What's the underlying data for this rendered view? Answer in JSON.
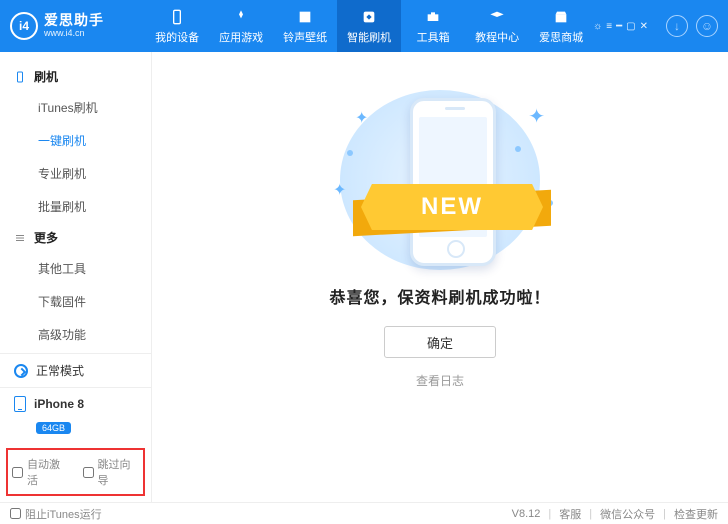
{
  "header": {
    "brand": "爱思助手",
    "url": "www.i4.cn",
    "logo_text": "i4",
    "tabs": [
      {
        "label": "我的设备"
      },
      {
        "label": "应用游戏"
      },
      {
        "label": "铃声壁纸"
      },
      {
        "label": "智能刷机"
      },
      {
        "label": "工具箱"
      },
      {
        "label": "教程中心"
      },
      {
        "label": "爱思商城"
      }
    ],
    "download_glyph": "↓",
    "user_glyph": "☺"
  },
  "sidebar": {
    "sections": [
      {
        "title": "刷机",
        "items": [
          "iTunes刷机",
          "一键刷机",
          "专业刷机",
          "批量刷机"
        ],
        "active_index": 1
      },
      {
        "title": "更多",
        "items": [
          "其他工具",
          "下载固件",
          "高级功能"
        ]
      }
    ],
    "mode": "正常模式",
    "device": {
      "name": "iPhone 8",
      "capacity": "64GB"
    },
    "options": {
      "auto_activate": "自动激活",
      "skip_guide": "跳过向导"
    }
  },
  "main": {
    "ribbon_text": "NEW",
    "success_message": "恭喜您，保资料刷机成功啦！",
    "confirm_label": "确定",
    "view_log": "查看日志"
  },
  "footer": {
    "block_itunes": "阻止iTunes运行",
    "version": "V8.12",
    "links": [
      "客服",
      "微信公众号",
      "检查更新"
    ]
  }
}
